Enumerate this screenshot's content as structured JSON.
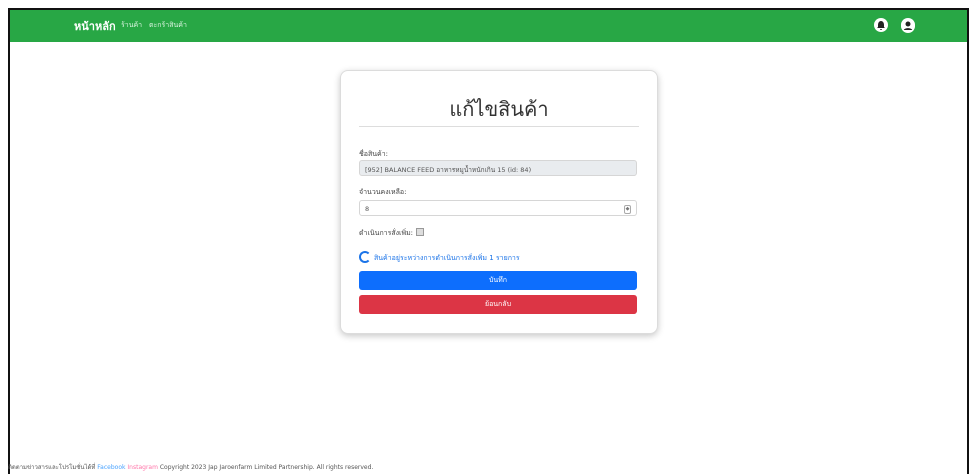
{
  "header": {
    "brand": "หน้าหลัก",
    "links": [
      "ร้านค้า",
      "ตะกร้าสินค้า"
    ],
    "icons": [
      "bell-icon",
      "user-icon"
    ]
  },
  "form": {
    "title": "แก้ไขสินค้า",
    "product_label": "ชื่อสินค้า:",
    "product_value": "[952] BALANCE FEED อาหารหมูน้ำหนักเกิน 15 (id: 84)",
    "quantity_label": "จำนวนคงเหลือ:",
    "quantity_value": "8",
    "extra_label": "ดำเนินการสั่งเพิ่ม:",
    "info_text": "สินค้าอยู่ระหว่างการดำเนินการสั่งเพิ่ม 1 รายการ",
    "save_label": "บันทึก",
    "back_label": "ย้อนกลับ"
  },
  "footer": {
    "text": "ติดตามข่าวสารและโปรโมชั่นได้ที่",
    "facebook": "Facebook",
    "instagram": "Instagram",
    "copyright": "Copyright 2023 Jap Jaroenfarm Limited Partnership. All rights reserved."
  }
}
